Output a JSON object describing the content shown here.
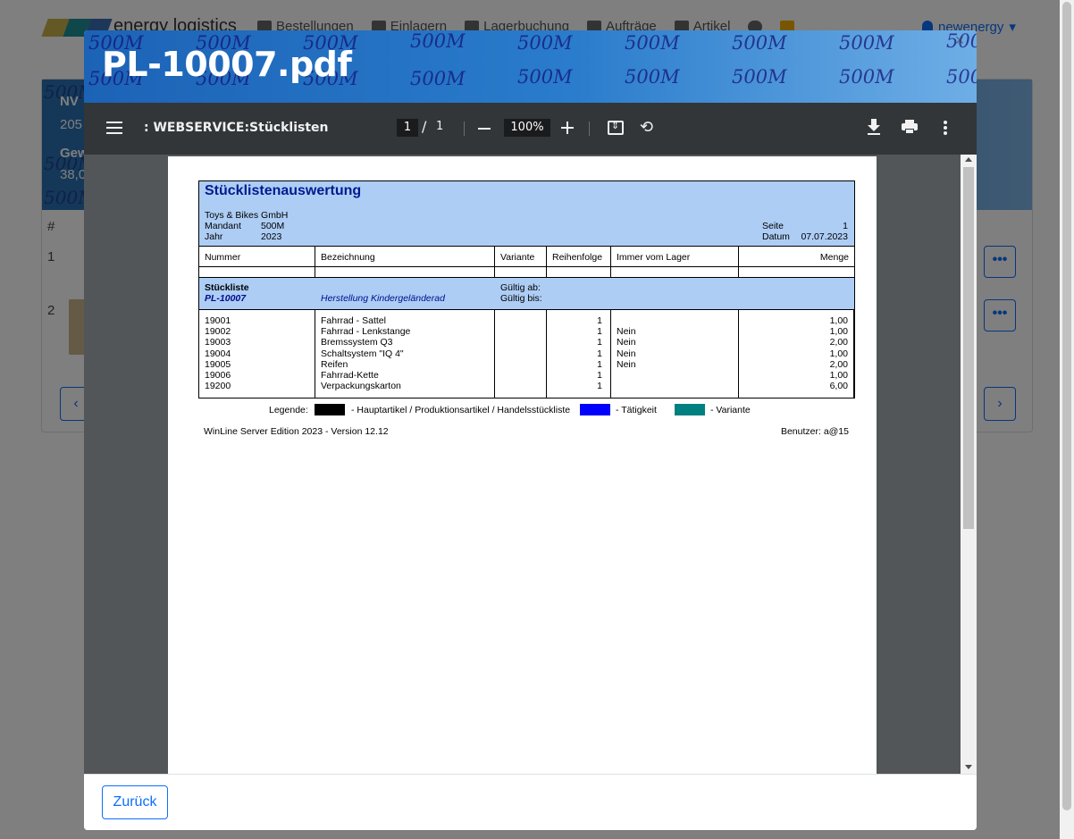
{
  "app": {
    "brand": "energy logistics",
    "brand_colors": [
      "#c9b24a",
      "#1f8f96",
      "#3a6fb7"
    ],
    "nav": [
      "Bestellungen",
      "Einlagern",
      "Lagerbuchung",
      "Aufträge",
      "Artikel"
    ],
    "user": "newenergy"
  },
  "background": {
    "watermark": "500M",
    "stat_labels": [
      "NV",
      "Gew"
    ],
    "stat_values": [
      "205",
      "38,0"
    ],
    "table_hash": "#",
    "rows": [
      "1",
      "2"
    ],
    "more_label": "•••",
    "prev_label": "‹",
    "next_label": "›"
  },
  "modal": {
    "title": "PL-10007.pdf",
    "watermark": "500M",
    "close_label": "×",
    "back_button": "Zurück"
  },
  "viewer": {
    "doc_title": ": WEBSERVICE:Stücklisten",
    "current_page": "1",
    "page_sep": "/",
    "total_pages": "1",
    "zoom": "100%"
  },
  "report": {
    "title": "Stücklistenauswertung",
    "company": "Toys & Bikes GmbH",
    "mandant_label": "Mandant",
    "mandant_value": "500M",
    "jahr_label": "Jahr",
    "jahr_value": "2023",
    "seite_label": "Seite",
    "seite_value": "1",
    "datum_label": "Datum",
    "datum_value": "07.07.2023",
    "columns": [
      "Nummer",
      "Bezeichnung",
      "Variante",
      "Reihenfolge",
      "Immer vom Lager",
      "Menge"
    ],
    "stueckliste_label": "Stückliste",
    "stueckliste_number": "PL-10007",
    "stueckliste_desc": "Herstellung Kindergeländerad",
    "gueltig_ab": "Gültig ab:",
    "gueltig_bis": "Gültig bis:",
    "items": [
      {
        "nummer": "19001",
        "bezeichnung": "Fahrrad - Sattel",
        "reihenfolge": "1",
        "lager": "",
        "menge": "1,00"
      },
      {
        "nummer": "19002",
        "bezeichnung": "Fahrrad - Lenkstange",
        "reihenfolge": "1",
        "lager": "Nein",
        "menge": "1,00"
      },
      {
        "nummer": "19003",
        "bezeichnung": "Bremssystem Q3",
        "reihenfolge": "1",
        "lager": "Nein",
        "menge": "2,00"
      },
      {
        "nummer": "19004",
        "bezeichnung": "Schaltsystem \"IQ 4\"",
        "reihenfolge": "1",
        "lager": "Nein",
        "menge": "1,00"
      },
      {
        "nummer": "19005",
        "bezeichnung": "Reifen",
        "reihenfolge": "1",
        "lager": "Nein",
        "menge": "2,00"
      },
      {
        "nummer": "19006",
        "bezeichnung": "Fahrrad-Kette",
        "reihenfolge": "1",
        "lager": "",
        "menge": "1,00"
      },
      {
        "nummer": "19200",
        "bezeichnung": "Verpackungskarton",
        "reihenfolge": "1",
        "lager": "",
        "menge": "6,00"
      }
    ],
    "legend_label": "Legende:",
    "legend": [
      {
        "color": "#000000",
        "text": "- Hauptartikel / Produktionsartikel / Handelsstückliste"
      },
      {
        "color": "#0000ff",
        "text": "- Tätigkeit"
      },
      {
        "color": "#008080",
        "text": "- Variante"
      }
    ],
    "footer_left": "WinLine Server Edition 2023 - Version 12.12",
    "footer_right": "Benutzer: a@15"
  }
}
